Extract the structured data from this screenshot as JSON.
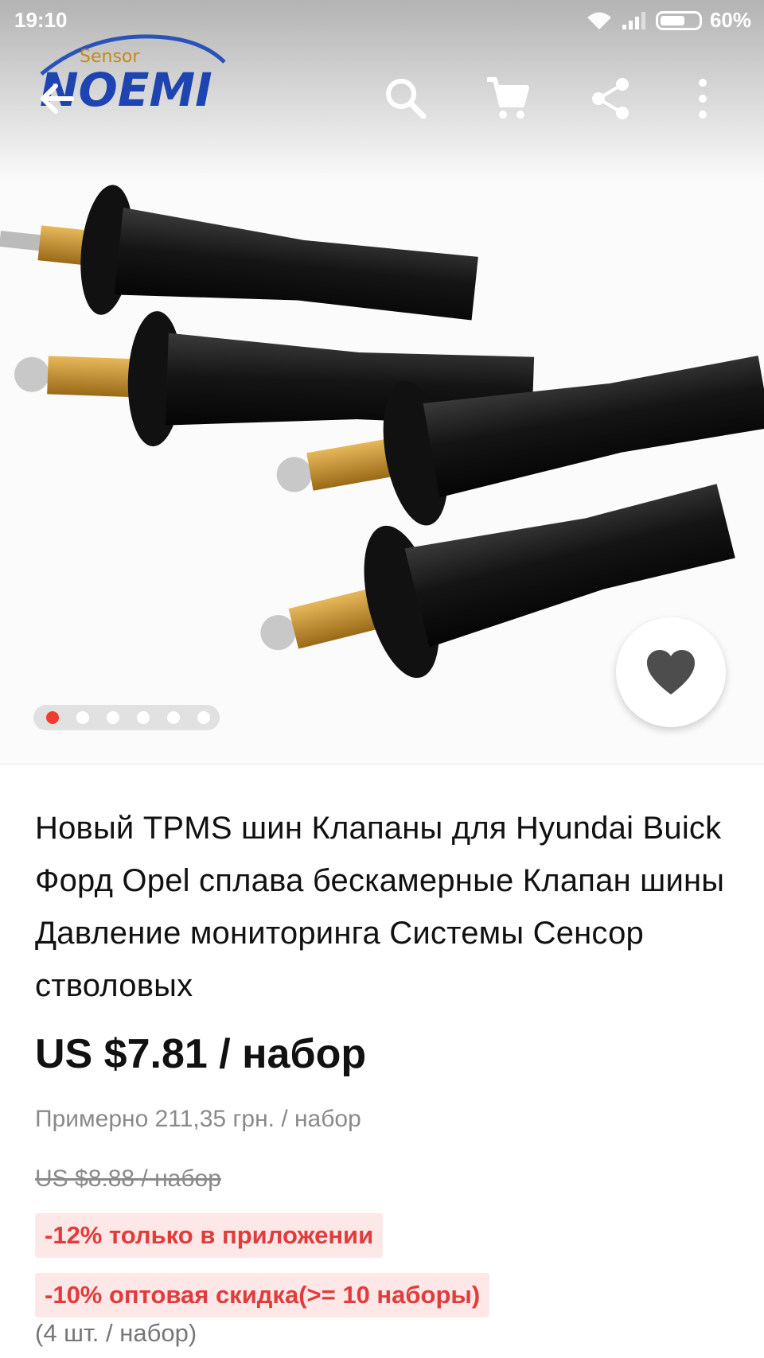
{
  "status": {
    "time": "19:10",
    "battery": "60%"
  },
  "logo": {
    "top_text": "Sensor",
    "main_text": "NOEMI"
  },
  "gallery": {
    "total_images": 6,
    "active_index": 0
  },
  "colors": {
    "accent": "#f23b2f",
    "promo_bg": "#fde7e7",
    "promo_text": "#e23b3b"
  },
  "product": {
    "title": "Новый TPMS шин Клапаны для Hyundai Buick Форд Opel сплава бескамерные Клапан шины Давление мониторинга Системы Сенсор стволовых",
    "price": "US $7.81 / набор",
    "approx_price": "Примерно 211,35 грн. / набор",
    "old_price": "US $8.88 / набор",
    "promo_app": "-12% только в приложении",
    "promo_wholesale": "-10% оптовая скидка(>= 10 наборы)",
    "pack_info": "(4 шт. / набор)"
  },
  "icons": [
    "back-arrow-icon",
    "search-icon",
    "cart-icon",
    "share-icon",
    "more-vertical-icon",
    "wifi-icon",
    "signal-icon",
    "battery-icon",
    "heart-icon"
  ]
}
